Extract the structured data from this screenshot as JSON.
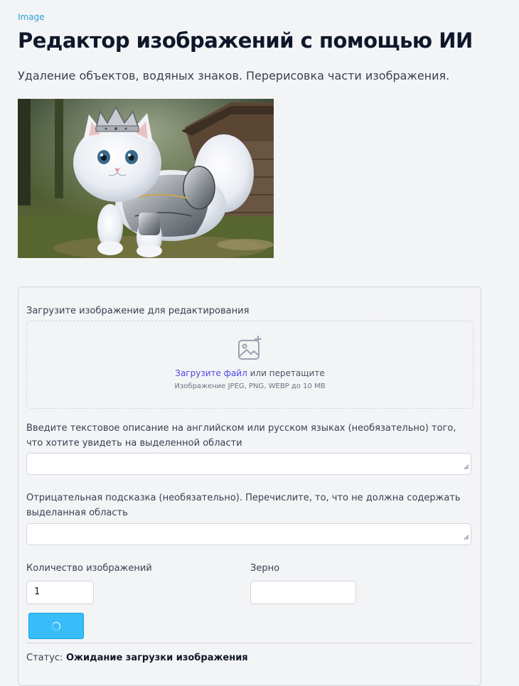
{
  "breadcrumb": "Image",
  "header": {
    "title": "Редактор изображений с помощью ИИ",
    "subtitle": "Удаление объектов, водяных знаков. Перерисовка части изображения."
  },
  "hero_image": {
    "icon": "cat-knight-image"
  },
  "form": {
    "upload": {
      "label": "Загрузите изображение для редактирования",
      "icon": "image-plus-icon",
      "link_text": "Загрузите файл",
      "drag_text": " или перетащите",
      "hint": "Изображение JPEG, PNG, WEBP до 10 MB"
    },
    "prompt": {
      "label": "Введите текстовое описание на английском или русском языках (необязательно) того, что хотите увидеть на выделенной области",
      "value": ""
    },
    "negative_prompt": {
      "label": "Отрицательная подсказка (необязательно). Перечислите, то, что не должна содержать выделанная область",
      "value": ""
    },
    "count": {
      "label": "Количество изображений",
      "value": "1"
    },
    "seed": {
      "label": "Зерно",
      "value": ""
    },
    "submit": {
      "icon": "spinner-icon"
    },
    "status": {
      "label": "Статус:",
      "value": "Ожидание загрузки изображения"
    }
  },
  "colors": {
    "accent": "#38bdf8",
    "link": "#4f46e5",
    "breadcrumb": "#2b9ed8",
    "background": "#f3f4f6"
  }
}
